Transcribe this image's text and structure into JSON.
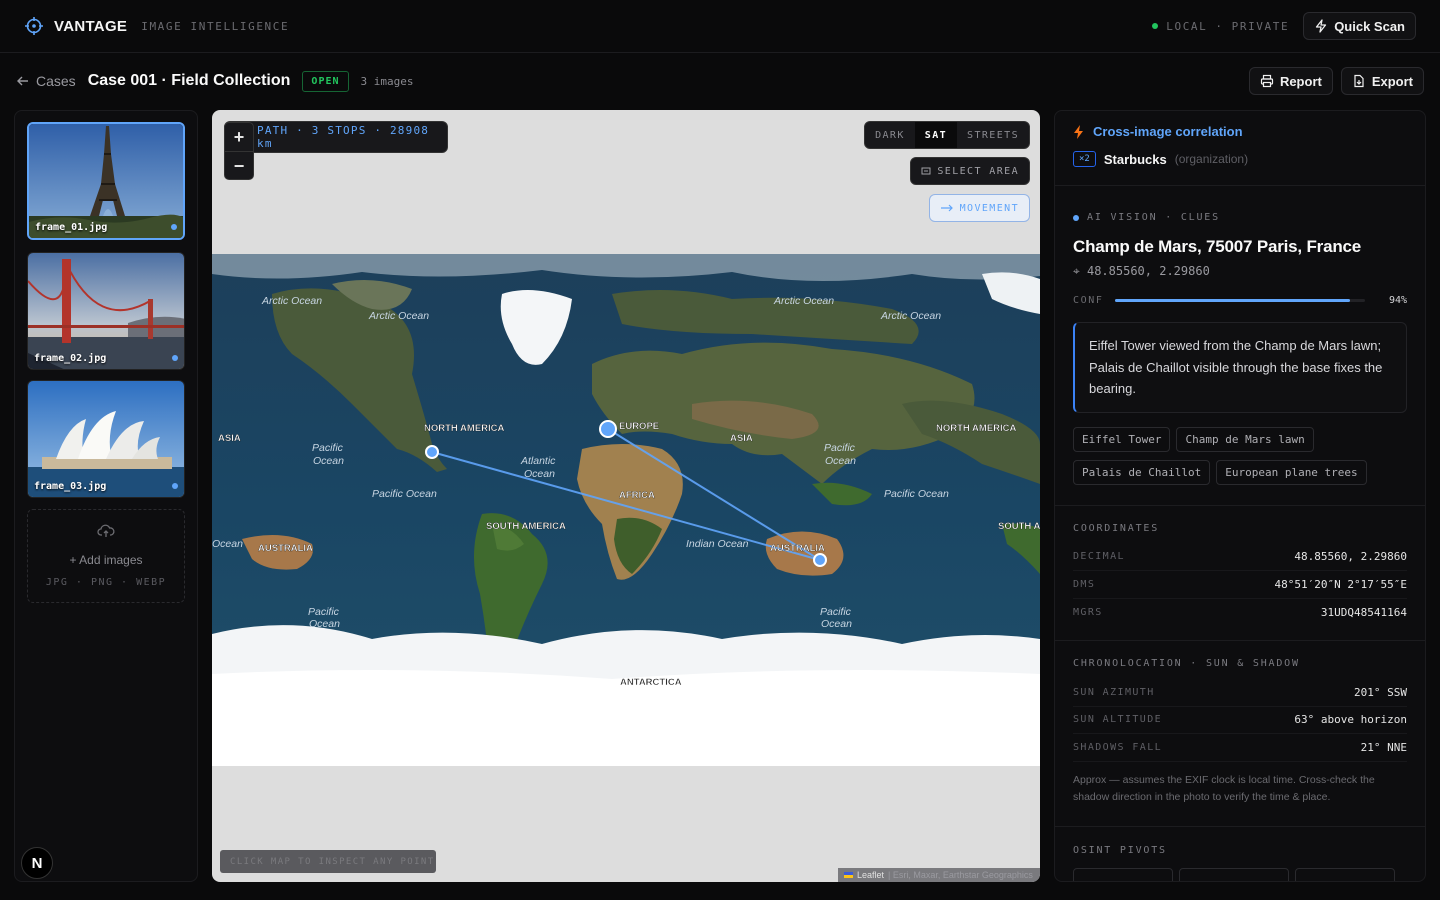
{
  "app": {
    "name": "VANTAGE",
    "subtitle": "IMAGE INTELLIGENCE"
  },
  "top": {
    "status_local": "LOCAL",
    "status_sep": "·",
    "status_private": "PRIVATE",
    "quick_scan": "Quick Scan"
  },
  "subheader": {
    "back": "Cases",
    "title": "Case 001 · Field Collection",
    "badge": "OPEN",
    "count": "3 images",
    "report": "Report",
    "export": "Export"
  },
  "images": [
    {
      "name": "frame_01.jpg",
      "selected": true
    },
    {
      "name": "frame_02.jpg",
      "selected": false
    },
    {
      "name": "frame_03.jpg",
      "selected": false
    }
  ],
  "add": {
    "label": "+ Add images",
    "formats": "JPG · PNG · WEBP"
  },
  "nav_logo": "N",
  "map": {
    "zoom_in": "+",
    "zoom_out": "−",
    "path": "PATH · 3 STOPS · 28908 km",
    "layers": [
      "DARK",
      "SAT",
      "STREETS"
    ],
    "active_layer": "SAT",
    "select_area": "SELECT AREA",
    "movement": "MOVEMENT",
    "inspect_hint": "CLICK MAP TO INSPECT ANY POINT",
    "attribution": {
      "leaflet": "Leaflet",
      "rest": "| Esri, Maxar, Earthstar Geographics"
    },
    "labels": {
      "arctic": "Arctic Ocean",
      "pacific": "Pacific",
      "ocean": "Ocean",
      "pacific_ocean": "Pacific Ocean",
      "atlantic": "Atlantic",
      "indian_ocean": "Indian Ocean",
      "ocean_frag": "Ocean",
      "north_america": "NORTH AMERICA",
      "south_america": "SOUTH AMERICA",
      "south_a": "SOUTH A",
      "europe": "EUROPE",
      "asia": "ASIA",
      "africa": "AFRICA",
      "australia": "AUSTRALIA",
      "antarctica": "ANTARCTICA"
    }
  },
  "correlation": {
    "title": "Cross-image correlation",
    "count": "×2",
    "entity": "Starbucks",
    "type": "(organization)"
  },
  "clues": {
    "kicker": "AI VISION · CLUES",
    "location": "Champ de Mars, 75007 Paris, France",
    "coords": "⌖ 48.85560, 2.29860",
    "conf_label": "CONF",
    "conf_value": "94%",
    "conf_fraction": 0.94,
    "reasoning": "Eiffel Tower viewed from the Champ de Mars lawn; Palais de Chaillot visible through the base fixes the bearing.",
    "tags": [
      "Eiffel Tower",
      "Champ de Mars lawn",
      "Palais de Chaillot",
      "European plane trees"
    ]
  },
  "coordinates": {
    "kicker": "COORDINATES",
    "rows": [
      {
        "k": "DECIMAL",
        "v": "48.85560, 2.29860"
      },
      {
        "k": "DMS",
        "v": "48°51′20″N 2°17′55″E"
      },
      {
        "k": "MGRS",
        "v": "31UDQ48541164"
      }
    ]
  },
  "chrono": {
    "kicker": "CHRONOLOCATION · SUN & SHADOW",
    "rows": [
      {
        "k": "SUN AZIMUTH",
        "v": "201° SSW"
      },
      {
        "k": "SUN ALTITUDE",
        "v": "63° above horizon"
      },
      {
        "k": "SHADOWS FALL",
        "v": "21° NNE"
      }
    ],
    "note": "Approx — assumes the EXIF clock is local time. Cross-check the shadow direction in the photo to verify the time & place."
  },
  "osint": {
    "kicker": "OSINT PIVOTS"
  },
  "colors": {
    "accent": "#60a5fa",
    "green": "#22c55e",
    "bg": "#0a0a0b"
  }
}
